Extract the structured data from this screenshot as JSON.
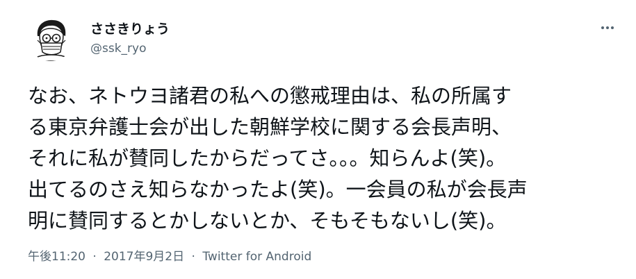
{
  "tweet": {
    "author": {
      "display_name": "ささきりょう",
      "handle": "@ssk_ryo"
    },
    "more_icon": "more-horizontal-icon",
    "body_lines": [
      "なお、ネトウヨ諸君の私への懲戒理由は、私の所属す",
      "る東京弁護士会が出した朝鮮学校に関する会長声明、",
      "それに私が賛同したからだってさ。。。知らんよ(笑)。",
      "出てるのさえ知らなかったよ(笑)。一会員の私が会長声",
      "明に賛同するとかしないとか、そもそもないし(笑)。"
    ],
    "meta": {
      "time": "午後11:20",
      "separator1": "·",
      "date": "2017年9月2日",
      "separator2": "·",
      "source": "Twitter for Android"
    }
  },
  "colors": {
    "text_primary": "#0f1419",
    "text_secondary": "#536471",
    "background": "#ffffff"
  }
}
